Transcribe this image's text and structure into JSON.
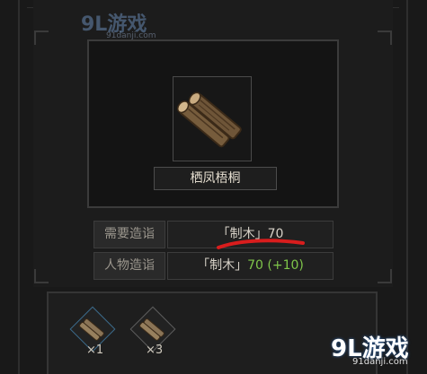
{
  "item": {
    "name": "栖凤梧桐",
    "icon": "wood-log-icon"
  },
  "requirements": [
    {
      "label": "需要造诣",
      "value": "「制木」70",
      "bonus": ""
    },
    {
      "label": "人物造诣",
      "value": "「制木」",
      "bonus": "70 (+10)"
    }
  ],
  "materials": [
    {
      "icon": "wood-material-icon",
      "count": "×1"
    },
    {
      "icon": "wood-material-icon",
      "count": "×3"
    }
  ],
  "watermark": {
    "top_logo": "9L游戏",
    "top_url": "91danji.com",
    "bottom_logo": "9L游戏",
    "bottom_url": "91danji.com"
  },
  "colors": {
    "bonus_green": "#7fc64a",
    "annotation_red": "#d81d1d"
  }
}
